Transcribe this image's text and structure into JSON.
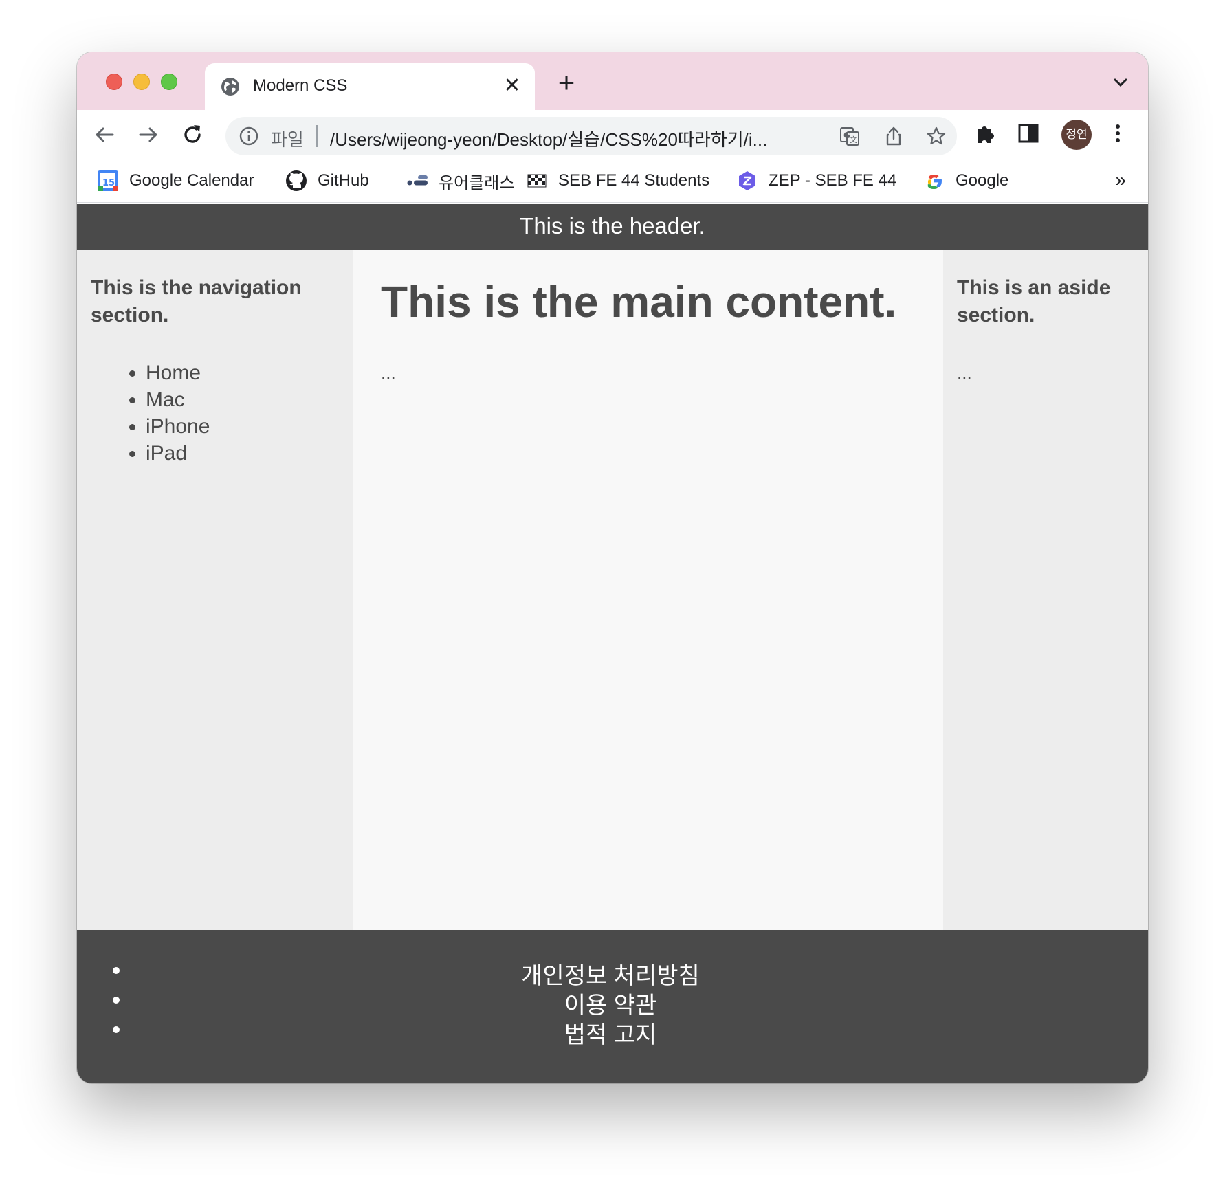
{
  "browser": {
    "tab_title": "Modern CSS",
    "omnibox": {
      "scheme_label": "파일",
      "url": "/Users/wijeong-yeon/Desktop/실습/CSS%20따라하기/i..."
    },
    "profile_label": "정연",
    "bookmarks": [
      {
        "label": "Google Calendar",
        "icon": "google-calendar-icon"
      },
      {
        "label": "GitHub",
        "icon": "github-icon"
      },
      {
        "label": "유어클래스",
        "icon": "urclass-icon"
      },
      {
        "label": "SEB FE 44 Students",
        "icon": "checkered-flag-icon"
      },
      {
        "label": "ZEP - SEB FE 44",
        "icon": "zep-icon"
      },
      {
        "label": "Google",
        "icon": "google-icon"
      }
    ],
    "bookmarks_overflow": "»",
    "colors": {
      "tabstrip": "#f2d7e3",
      "profile_bg": "#5d3e36"
    }
  },
  "page": {
    "header": "This is the header.",
    "nav": {
      "heading": "This is the navigation section.",
      "items": [
        "Home",
        "Mac",
        "iPhone",
        "iPad"
      ]
    },
    "main": {
      "heading": "This is the main content.",
      "body": "..."
    },
    "aside": {
      "heading": "This is an aside section.",
      "body": "..."
    },
    "footer": {
      "links": [
        "개인정보 처리방침",
        "이용 약관",
        "법적 고지"
      ]
    },
    "colors": {
      "dark_band": "#4a4a4a",
      "side_bg": "#ededed",
      "main_bg": "#f8f8f8"
    }
  }
}
